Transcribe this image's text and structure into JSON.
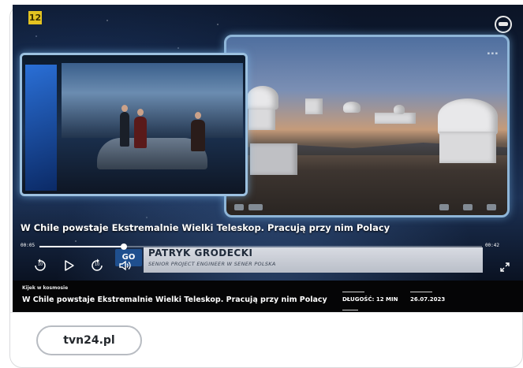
{
  "player": {
    "channel_badge": "12",
    "headline": "W Chile powstaje Ekstremalnie Wielki Teleskop. Pracują przy nim Polacy",
    "time_elapsed": "00:05",
    "time_total": "00:42",
    "progress": 0.19,
    "lower_third": {
      "logo": "GO",
      "name": "PATRYK GRODECKI",
      "role": "SENIOR PROJECT ENGINEER W SENER POLSKA"
    },
    "rewind_label": "10",
    "forward_label": "10"
  },
  "info": {
    "kicker": "Kijek w kosmosie",
    "title": "W Chile powstaje Ekstremalnie Wielki Teleskop. Pracują przy nim Polacy",
    "duration": "DŁUGOŚĆ: 12 MIN",
    "date": "26.07.2023"
  },
  "source": {
    "label": "tvn24.pl"
  },
  "icons": [
    "channel-logo-icon",
    "rewind-10-icon",
    "play-icon",
    "forward-10-icon",
    "volume-icon",
    "fullscreen-icon"
  ]
}
